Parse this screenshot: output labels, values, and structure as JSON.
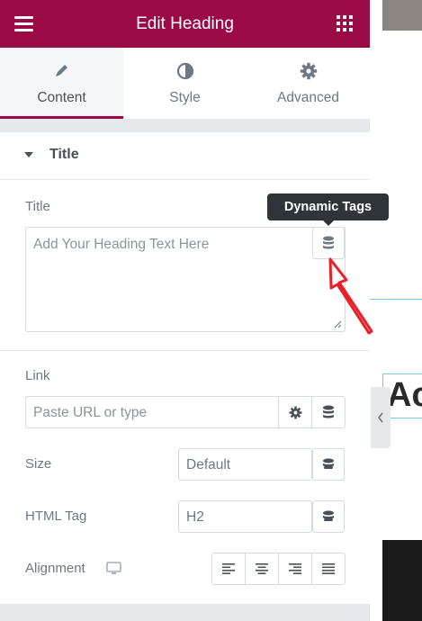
{
  "header": {
    "title": "Edit Heading",
    "menu_icon": "hamburger-icon",
    "grid_icon": "grid-icon"
  },
  "tabs": [
    {
      "label": "Content",
      "icon": "pencil-icon",
      "active": true
    },
    {
      "label": "Style",
      "icon": "half-circle-icon",
      "active": false
    },
    {
      "label": "Advanced",
      "icon": "gear-icon",
      "active": false
    }
  ],
  "section": {
    "title": "Title",
    "expanded": true
  },
  "fields": {
    "title": {
      "label": "Title",
      "placeholder": "Add Your Heading Text Here"
    },
    "link": {
      "label": "Link",
      "placeholder": "Paste URL or type"
    },
    "size": {
      "label": "Size",
      "value": "Default"
    },
    "html_tag": {
      "label": "HTML Tag",
      "value": "H2"
    },
    "alignment": {
      "label": "Alignment",
      "options": [
        "left",
        "center",
        "right",
        "justify"
      ]
    }
  },
  "tooltip": {
    "text": "Dynamic Tags"
  },
  "preview": {
    "heading_fragment": "Ac"
  },
  "colors": {
    "brand": "#9b0a46",
    "annotation_arrow": "#e8202a",
    "tooltip_bg": "#2f3439"
  }
}
